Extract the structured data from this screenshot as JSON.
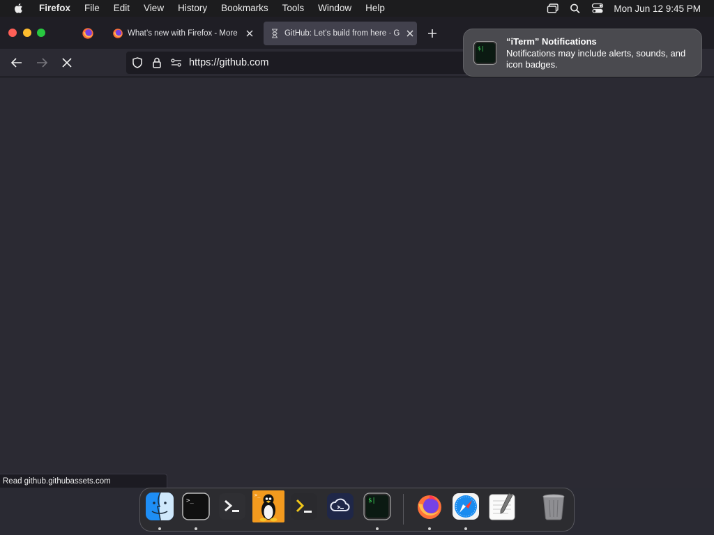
{
  "menubar": {
    "app_name": "Firefox",
    "items": [
      "File",
      "Edit",
      "View",
      "History",
      "Bookmarks",
      "Tools",
      "Window",
      "Help"
    ],
    "clock": "Mon Jun 12  9:45 PM"
  },
  "tabs": [
    {
      "title": "What’s new with Firefox - More"
    },
    {
      "title": "GitHub: Let’s build from here · G"
    }
  ],
  "address_bar": {
    "url": "https://github.com"
  },
  "status_bar": {
    "text": "Read github.githubassets.com"
  },
  "notification": {
    "title": "“iTerm” Notifications",
    "body": "Notifications may include alerts, sounds, and icon badges."
  },
  "dock": {
    "items": [
      "finder-icon",
      "terminal-icon",
      "powershell-icon",
      "linux-terminal-icon",
      "console-icon",
      "cloud-app-icon",
      "iterm-icon",
      "firefox-icon",
      "safari-icon",
      "textedit-icon",
      "trash-icon"
    ]
  },
  "colors": {
    "accent_red": "#ff5f57",
    "accent_yellow": "#febc2e",
    "accent_green": "#28c840"
  }
}
